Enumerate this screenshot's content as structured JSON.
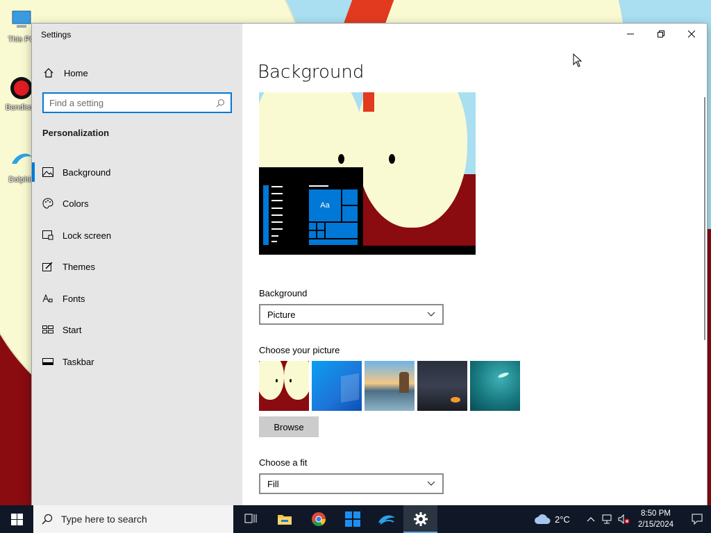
{
  "desktop": {
    "icons": [
      {
        "label": "This PC"
      },
      {
        "label": "Bandicam"
      },
      {
        "label": "Dolphin"
      }
    ]
  },
  "window": {
    "title": "Settings",
    "controls": {
      "minimize": "minimize-icon",
      "maximize": "restore-icon",
      "close": "close-icon"
    }
  },
  "sidebar": {
    "home_label": "Home",
    "search_placeholder": "Find a setting",
    "section_title": "Personalization",
    "items": [
      {
        "label": "Background",
        "icon": "picture-icon",
        "active": true
      },
      {
        "label": "Colors",
        "icon": "palette-icon"
      },
      {
        "label": "Lock screen",
        "icon": "lock-screen-icon"
      },
      {
        "label": "Themes",
        "icon": "themes-icon"
      },
      {
        "label": "Fonts",
        "icon": "fonts-icon"
      },
      {
        "label": "Start",
        "icon": "start-icon"
      },
      {
        "label": "Taskbar",
        "icon": "taskbar-icon"
      }
    ]
  },
  "main": {
    "title": "Background",
    "preview_sample_text": "Aa",
    "background_label": "Background",
    "background_value": "Picture",
    "choose_picture_label": "Choose your picture",
    "browse_label": "Browse",
    "fit_label": "Choose a fit",
    "fit_value": "Fill"
  },
  "taskbar": {
    "search_placeholder": "Type here to search",
    "weather_temp": "2°C",
    "time": "8:50 PM",
    "date": "2/15/2024"
  },
  "colors": {
    "accent": "#0078d7",
    "sidebar_bg": "#e6e6e6",
    "taskbar_bg": "#101827"
  }
}
